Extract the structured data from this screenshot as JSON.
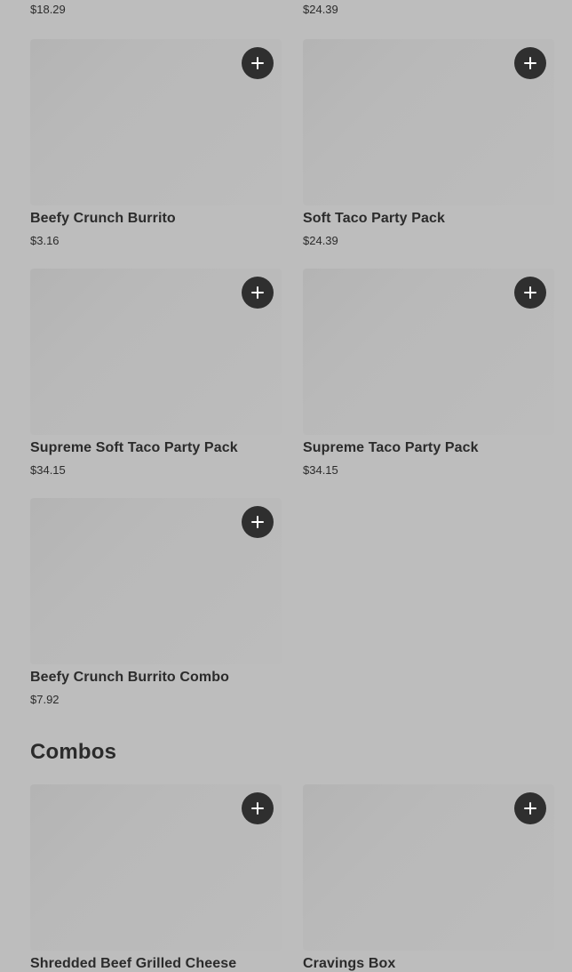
{
  "top_prices": [
    "$18.29",
    "$24.39"
  ],
  "group1_items": [
    {
      "name": "Beefy Crunch Burrito",
      "price": "$3.16"
    },
    {
      "name": "Soft Taco Party Pack",
      "price": "$24.39"
    },
    {
      "name": "Supreme Soft Taco Party Pack",
      "price": "$34.15"
    },
    {
      "name": "Supreme Taco Party Pack",
      "price": "$34.15"
    },
    {
      "name": "Beefy Crunch Burrito Combo",
      "price": "$7.92"
    }
  ],
  "combos_section": {
    "title": "Combos",
    "items": [
      {
        "name": "Shredded Beef Grilled Cheese"
      },
      {
        "name": "Cravings Box"
      }
    ]
  },
  "icons": {
    "add_button": "plus-icon"
  },
  "colors": {
    "background": "#bdbdbd",
    "add_button": "#2f2f2f",
    "text": "#2b2b2b"
  }
}
